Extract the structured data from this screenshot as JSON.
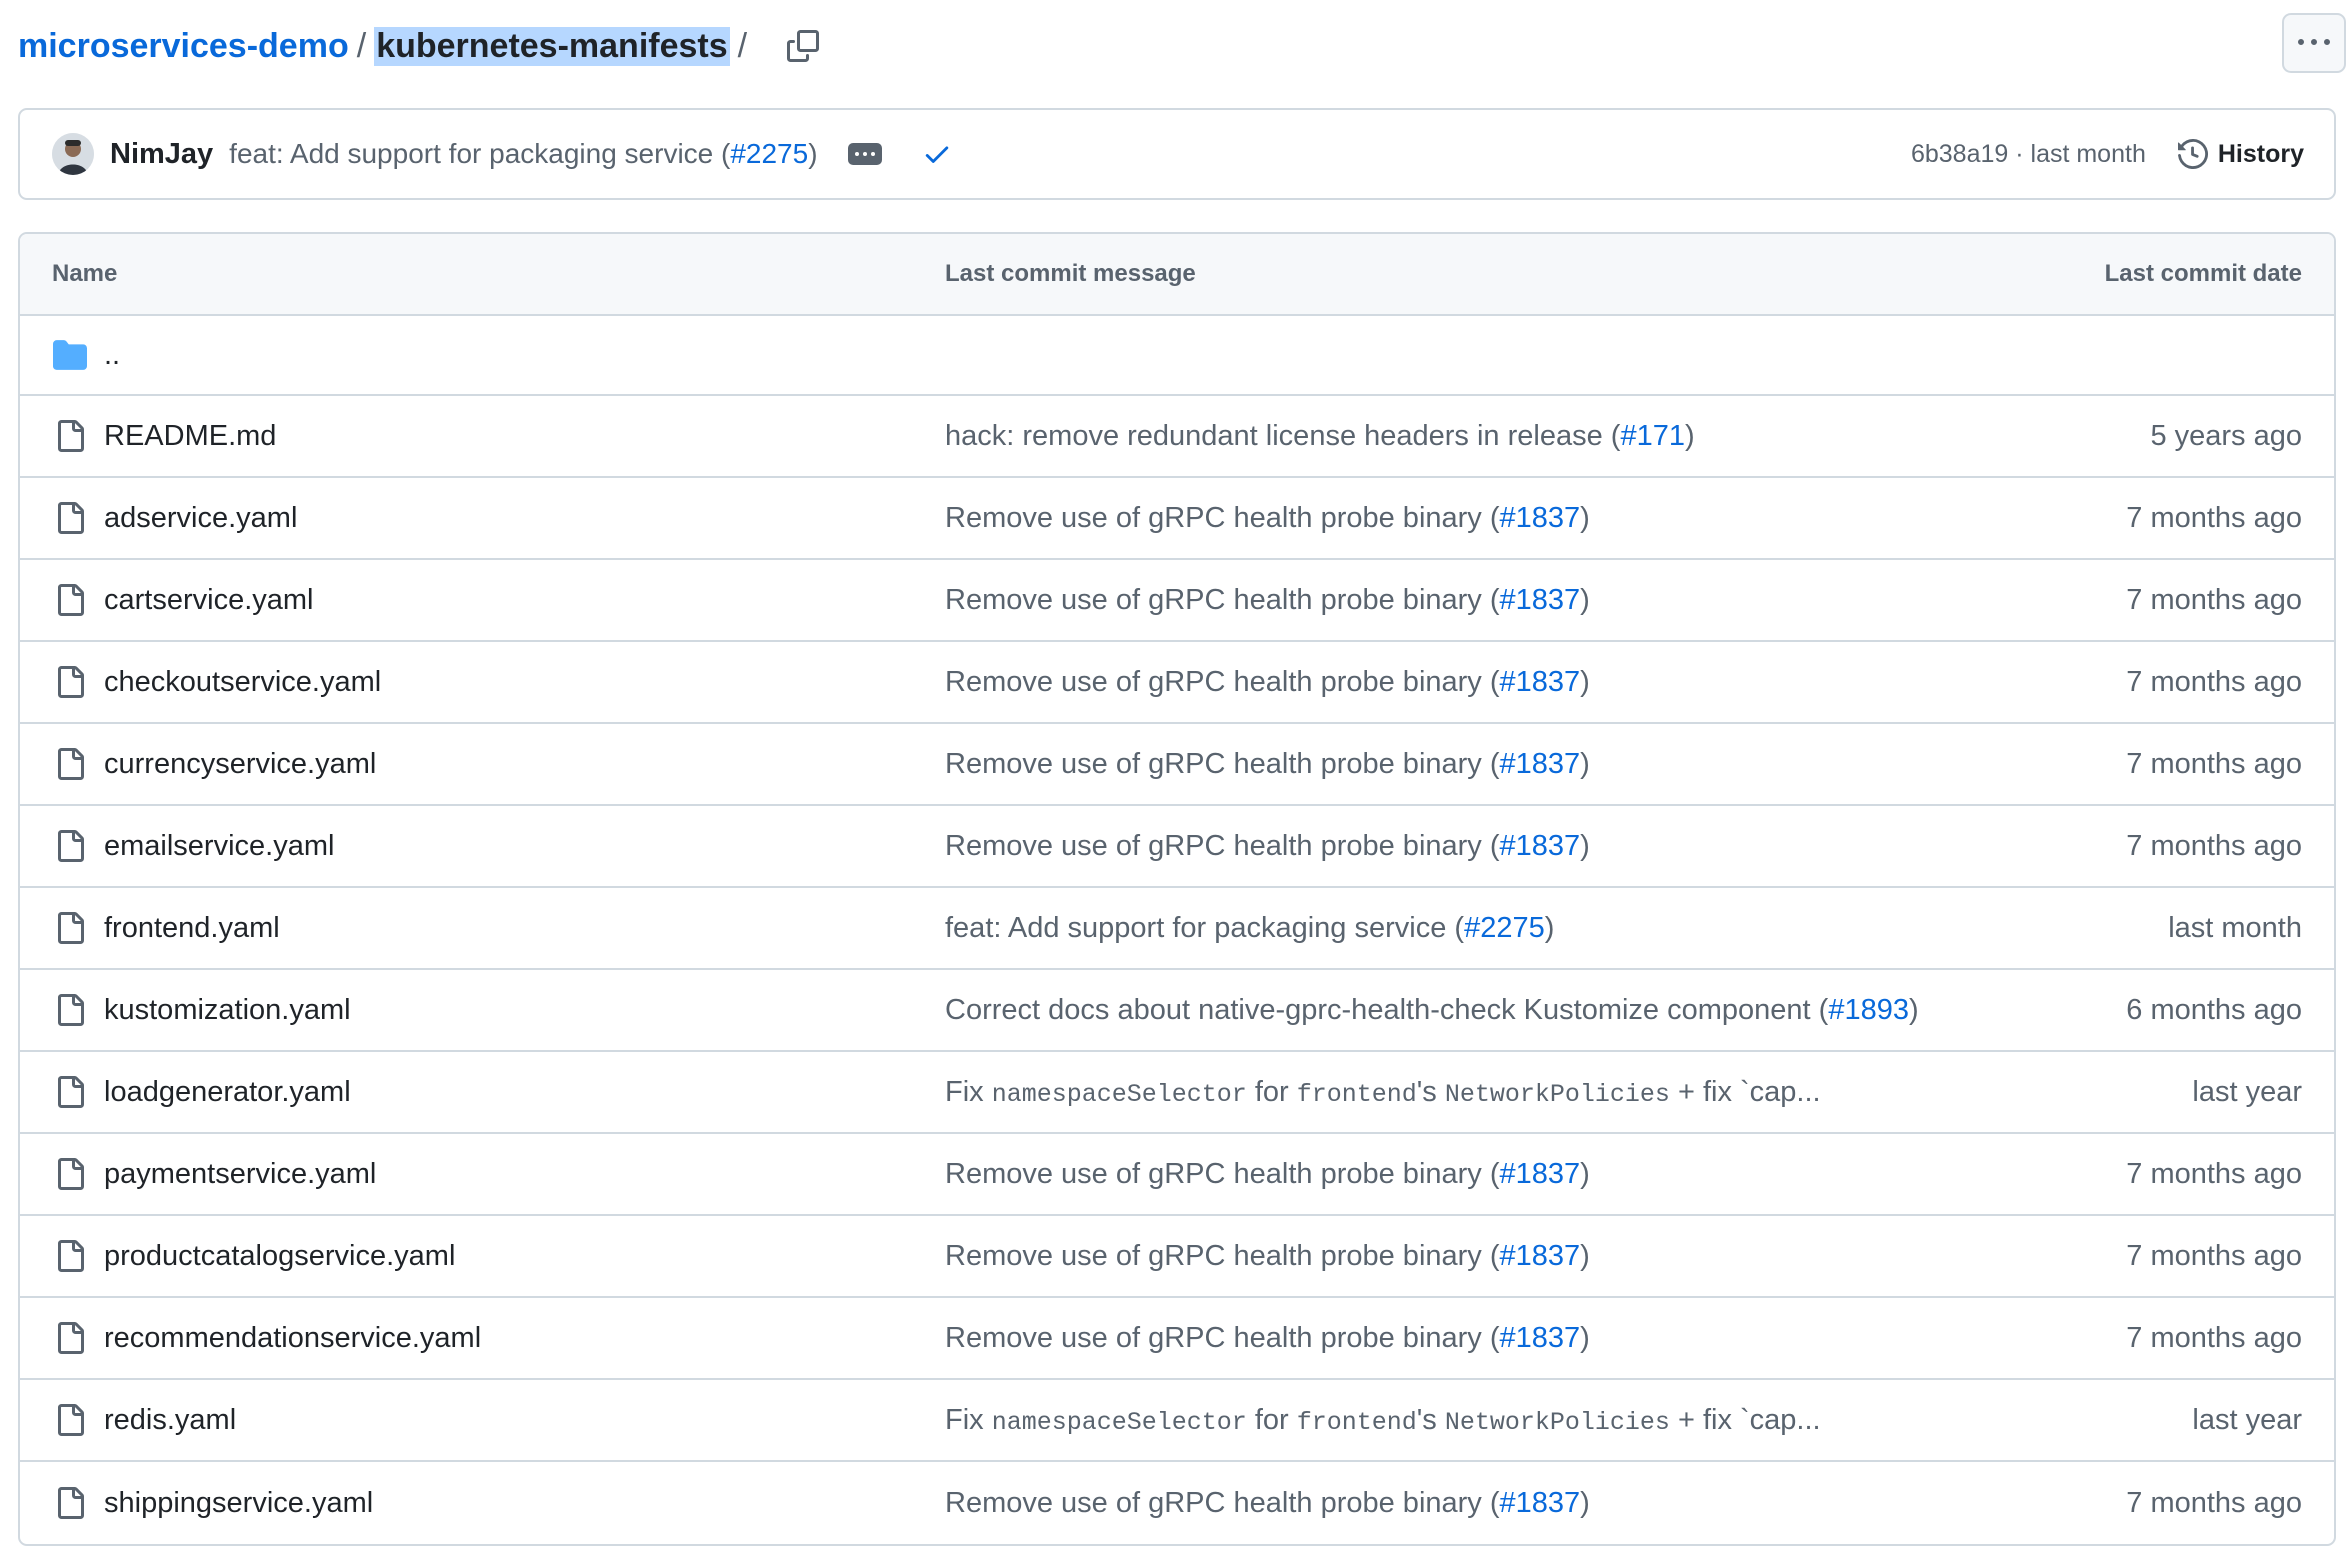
{
  "breadcrumb": {
    "repo": "microservices-demo",
    "separator": "/",
    "current": "kubernetes-manifests",
    "trailing_separator": "/"
  },
  "latest_commit": {
    "author": "NimJay",
    "message_prefix": "feat: Add support for packaging service (",
    "pr_link": "#2275",
    "message_suffix": ")",
    "sha_time": "6b38a19 · last month",
    "history_label": "History"
  },
  "table": {
    "headers": {
      "name": "Name",
      "message": "Last commit message",
      "date": "Last commit date"
    },
    "parent_label": "..",
    "rows": [
      {
        "name": "README.md",
        "msg_prefix": "hack: remove redundant license headers in release (",
        "link": "#171",
        "msg_suffix": ")",
        "date": "5 years ago"
      },
      {
        "name": "adservice.yaml",
        "msg_prefix": "Remove use of gRPC health probe binary (",
        "link": "#1837",
        "msg_suffix": ")",
        "date": "7 months ago"
      },
      {
        "name": "cartservice.yaml",
        "msg_prefix": "Remove use of gRPC health probe binary (",
        "link": "#1837",
        "msg_suffix": ")",
        "date": "7 months ago"
      },
      {
        "name": "checkoutservice.yaml",
        "msg_prefix": "Remove use of gRPC health probe binary (",
        "link": "#1837",
        "msg_suffix": ")",
        "date": "7 months ago"
      },
      {
        "name": "currencyservice.yaml",
        "msg_prefix": "Remove use of gRPC health probe binary (",
        "link": "#1837",
        "msg_suffix": ")",
        "date": "7 months ago"
      },
      {
        "name": "emailservice.yaml",
        "msg_prefix": "Remove use of gRPC health probe binary (",
        "link": "#1837",
        "msg_suffix": ")",
        "date": "7 months ago"
      },
      {
        "name": "frontend.yaml",
        "msg_prefix": "feat: Add support for packaging service (",
        "link": "#2275",
        "msg_suffix": ")",
        "date": "last month"
      },
      {
        "name": "kustomization.yaml",
        "msg_prefix": "Correct docs about native-gprc-health-check Kustomize component (",
        "link": "#1893",
        "msg_suffix": ")",
        "date": "6 months ago"
      },
      {
        "name": "loadgenerator.yaml",
        "code_msg": {
          "p1": "Fix ",
          "c1": "namespaceSelector",
          "p2": " for ",
          "c2": "frontend",
          "p3": "'s ",
          "c3": "NetworkPolicies",
          "p4": " + fix `cap..."
        },
        "date": "last year"
      },
      {
        "name": "paymentservice.yaml",
        "msg_prefix": "Remove use of gRPC health probe binary (",
        "link": "#1837",
        "msg_suffix": ")",
        "date": "7 months ago"
      },
      {
        "name": "productcatalogservice.yaml",
        "msg_prefix": "Remove use of gRPC health probe binary (",
        "link": "#1837",
        "msg_suffix": ")",
        "date": "7 months ago"
      },
      {
        "name": "recommendationservice.yaml",
        "msg_prefix": "Remove use of gRPC health probe binary (",
        "link": "#1837",
        "msg_suffix": ")",
        "date": "7 months ago"
      },
      {
        "name": "redis.yaml",
        "code_msg": {
          "p1": "Fix ",
          "c1": "namespaceSelector",
          "p2": " for ",
          "c2": "frontend",
          "p3": "'s ",
          "c3": "NetworkPolicies",
          "p4": " + fix `cap..."
        },
        "date": "last year"
      },
      {
        "name": "shippingservice.yaml",
        "msg_prefix": "Remove use of gRPC health probe binary (",
        "link": "#1837",
        "msg_suffix": ")",
        "date": "7 months ago"
      }
    ]
  },
  "icons": {
    "copy": "copy-icon",
    "more": "kebab-horizontal-icon",
    "folder": "folder-icon",
    "file": "file-icon",
    "history": "history-clock-icon",
    "check": "check-icon"
  },
  "colors": {
    "link": "#0969da",
    "muted": "#59636e",
    "border": "#d1d9e0",
    "folder": "#54aeff",
    "selection": "#b6d7ff"
  }
}
